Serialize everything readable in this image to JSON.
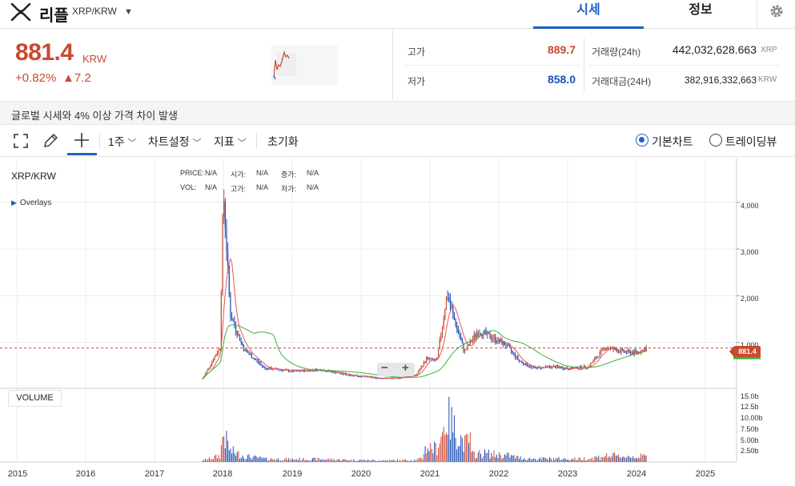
{
  "header": {
    "coin_name": "리플",
    "pair": "XRP/KRW",
    "tabs": [
      "시세",
      "정보"
    ]
  },
  "ticker": {
    "price": "881.4",
    "unit": "KRW",
    "change_pct": "+0.82%",
    "change_val": "▲7.2",
    "high_label": "고가",
    "high": "889.7",
    "low_label": "저가",
    "low": "858.0",
    "volume_label": "거래량(24h)",
    "volume": "442,032,628.663",
    "volume_unit": "XRP",
    "value_label": "거래대금(24H)",
    "value": "382,916,332,663",
    "value_unit": "KRW"
  },
  "notice": "글로벌 시세와 4% 이상 가격 차이 발생",
  "toolbar": {
    "period": "1주",
    "chart_settings": "차트설정",
    "indicators": "지표",
    "reset": "초기화",
    "basic_chart": "기본차트",
    "tradingview": "트레이딩뷰"
  },
  "chart": {
    "pair_label": "XRP/KRW",
    "overlays_label": "Overlays",
    "volume_label": "VOLUME",
    "legend": {
      "price_label": "PRICE:",
      "price": "N/A",
      "open_label": "시가:",
      "open": "N/A",
      "change_label": "증가:",
      "change": "N/A",
      "vol_label": "VOL:",
      "vol": "N/A",
      "high_label": "고가:",
      "high": "N/A",
      "low_label": "저가:",
      "low": "N/A"
    },
    "last_price_tag": "881.4",
    "y_ticks": [
      "4,000",
      "3,000",
      "2,000",
      "1,000"
    ],
    "vol_ticks": [
      "15.0b",
      "12.5b",
      "10.00b",
      "7.50b",
      "5.00b",
      "2.50b"
    ],
    "x_ticks": [
      "2015",
      "2016",
      "2017",
      "2018",
      "2019",
      "2020",
      "2021",
      "2022",
      "2023",
      "2024",
      "2025"
    ],
    "colors": {
      "up": "#c84a31",
      "down": "#1f4fb5",
      "ma_short": "#e05a5a",
      "ma_long": "#3bb33b",
      "accent": "#1f5fc4"
    }
  },
  "chart_data": {
    "type": "line",
    "title": "",
    "x_unit": "year",
    "x": [
      2017.7,
      2017.95,
      2018.0,
      2018.1,
      2018.3,
      2018.6,
      2018.8,
      2019.0,
      2019.4,
      2019.8,
      2020.2,
      2020.5,
      2020.8,
      2020.95,
      2021.1,
      2021.25,
      2021.35,
      2021.5,
      2021.7,
      2021.9,
      2022.1,
      2022.3,
      2022.5,
      2022.8,
      2023.0,
      2023.3,
      2023.55,
      2023.8,
      2024.0,
      2024.15
    ],
    "series": [
      {
        "values": [
          230,
          900,
          4250,
          1600,
          850,
          450,
          420,
          380,
          420,
          310,
          240,
          230,
          300,
          650,
          600,
          2050,
          1500,
          800,
          1250,
          1100,
          950,
          600,
          450,
          480,
          440,
          480,
          900,
          800,
          780,
          881.4
        ]
      }
    ],
    "ylim": [
      0,
      4900
    ],
    "volume": {
      "unit": "b",
      "ylim": [
        0,
        16
      ]
    },
    "last_price": 881.4
  }
}
